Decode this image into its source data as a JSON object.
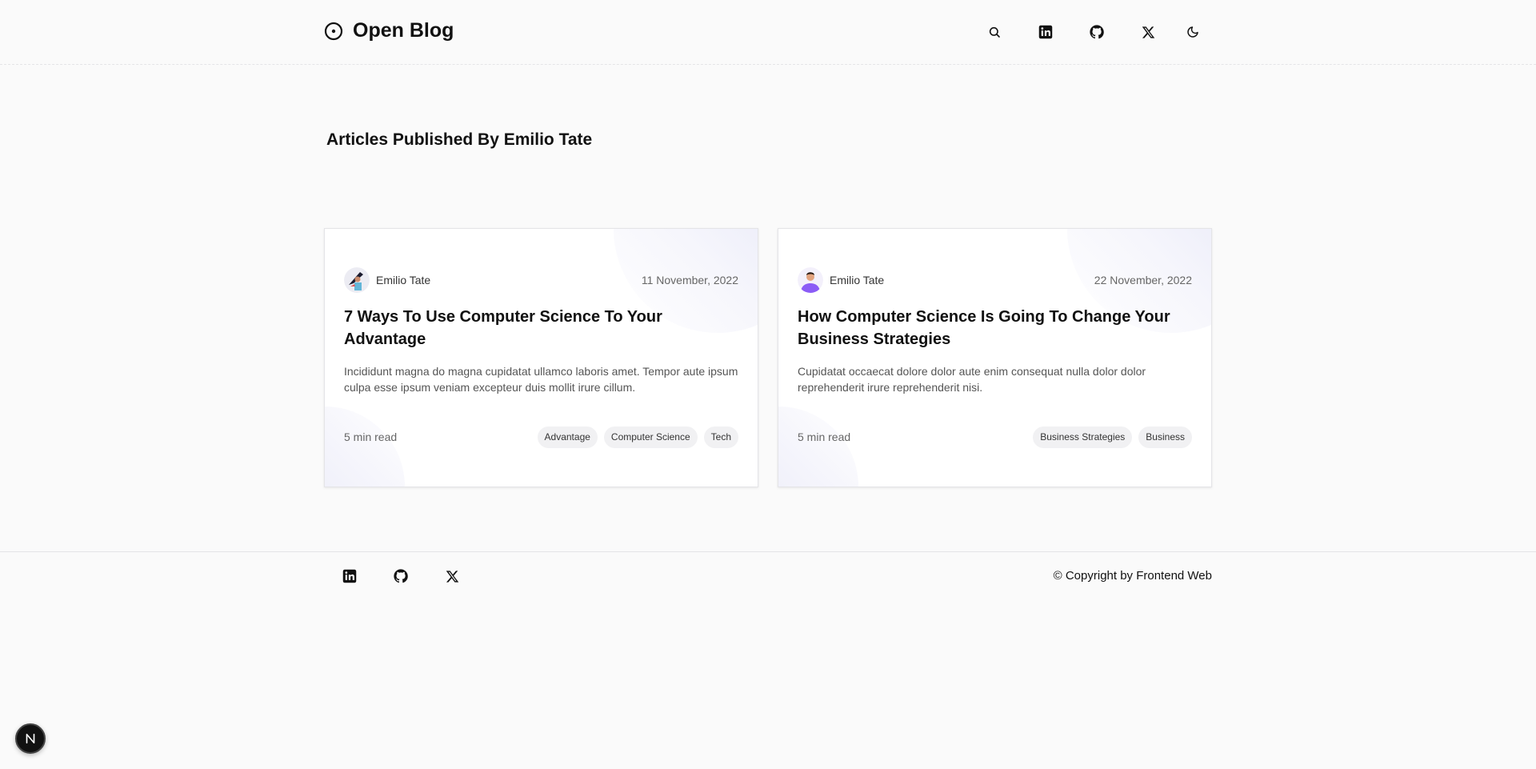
{
  "header": {
    "brand": "Open Blog",
    "icons": [
      "search-icon",
      "linkedin-icon",
      "github-icon",
      "x-icon",
      "moon-icon"
    ]
  },
  "page": {
    "title": "Articles Published By Emilio Tate"
  },
  "articles": [
    {
      "author": "Emilio Tate",
      "date": "11 November, 2022",
      "title": "7 Ways To Use Computer Science To Your Advantage",
      "excerpt": "Incididunt magna do magna cupidatat ullamco laboris amet. Tempor aute ipsum culpa esse ipsum veniam excepteur duis mollit irure cillum.",
      "read_time": "5 min read",
      "tags": [
        "Advantage",
        "Computer Science",
        "Tech"
      ]
    },
    {
      "author": "Emilio Tate",
      "date": "22 November, 2022",
      "title": "How Computer Science Is Going To Change Your Business Strategies",
      "excerpt": "Cupidatat occaecat dolore dolor aute enim consequat nulla dolor dolor reprehenderit irure reprehenderit nisi.",
      "read_time": "5 min read",
      "tags": [
        "Business Strategies",
        "Business"
      ]
    }
  ],
  "footer": {
    "icons": [
      "linkedin-icon",
      "github-icon",
      "x-icon"
    ],
    "copyright": "© Copyright by Frontend Web"
  },
  "colors": {
    "background": "#fafafa",
    "card": "#ffffff",
    "accent_blob": "#e0e2f6",
    "tag_bg": "#f1f1f3"
  }
}
